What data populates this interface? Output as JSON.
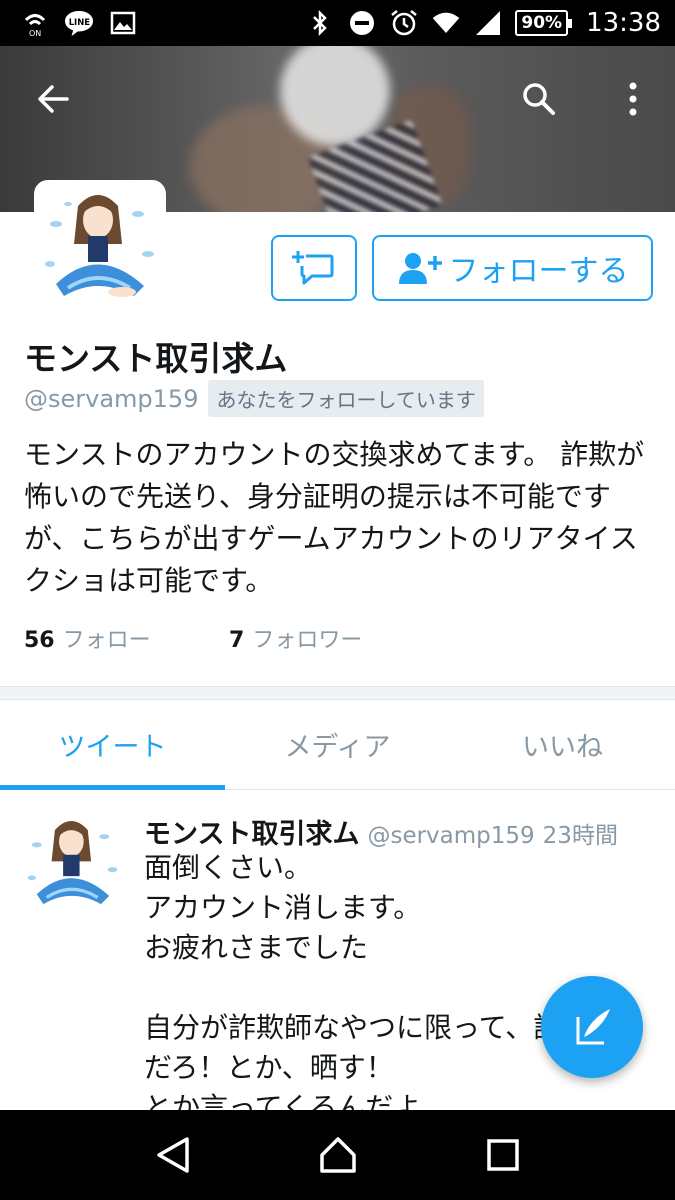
{
  "status_bar": {
    "time": "13:38",
    "battery": "90%",
    "line_label": "LINE",
    "on_label": "ON",
    "icons": [
      "wifi-calling-icon",
      "line-app-icon",
      "gallery-icon",
      "bluetooth-icon",
      "do-not-disturb-icon",
      "alarm-icon",
      "wifi-icon",
      "signal-icon",
      "battery-icon"
    ]
  },
  "header": {
    "back_icon": "arrow-left-icon",
    "search_icon": "search-icon",
    "more_icon": "more-vertical-icon"
  },
  "profile": {
    "name": "モンスト取引求ム",
    "handle": "@servamp159",
    "follows_you": "あなたをフォローしています",
    "bio": "モンストのアカウントの交換求めてます。 詐欺が怖いので先送り、身分証明の提示は不可能ですが、こちらが出すゲームアカウントのリアタイスクショは可能です。",
    "following_count": "56",
    "following_label": "フォロー",
    "followers_count": "7",
    "followers_label": "フォロワー"
  },
  "actions": {
    "follow_label": "フォローする"
  },
  "tabs": [
    {
      "label": "ツイート",
      "active": true
    },
    {
      "label": "メディア",
      "active": false
    },
    {
      "label": "いいね",
      "active": false
    }
  ],
  "tweet": {
    "name": "モンスト取引求ム",
    "handle": "@servamp159",
    "time": "23時間",
    "lines": [
      "面倒くさい。",
      "アカウント消します。",
      "お疲れさまでした",
      "",
      "自分が詐欺師なやつに限って、詐欺師",
      "だろ！とか、晒す！",
      "とか言ってくるんだよ"
    ]
  },
  "colors": {
    "accent": "#1da1f2",
    "muted": "#8899a6",
    "text": "#14171a"
  }
}
